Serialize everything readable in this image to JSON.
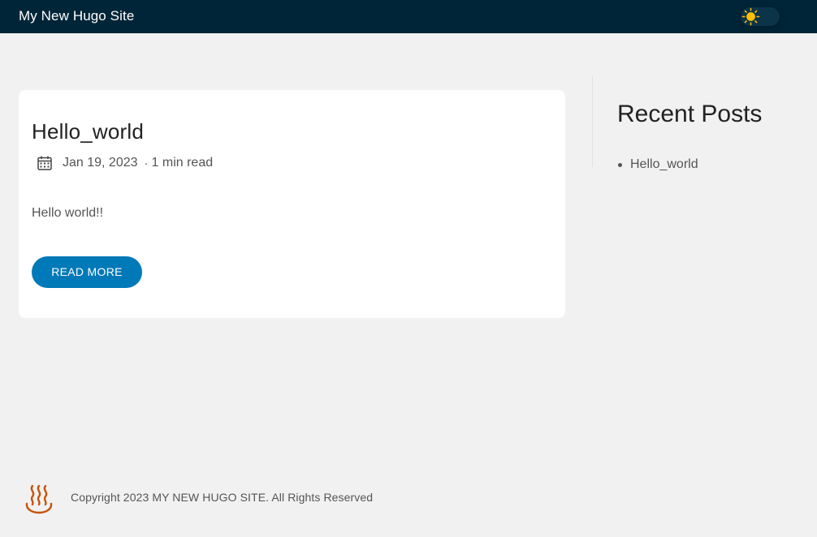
{
  "header": {
    "site_title": "My New Hugo Site",
    "theme_toggle_icon": "sun-icon",
    "theme_mode": "light"
  },
  "post": {
    "title": "Hello_world",
    "date": "Jan 19, 2023",
    "separator": "·",
    "reading_time": "1 min read",
    "summary": "Hello world!!",
    "read_more_label": "READ MORE"
  },
  "sidebar": {
    "title": "Recent Posts",
    "items": [
      {
        "label": "Hello_world"
      }
    ]
  },
  "footer": {
    "logo_icon": "hot-springs-icon",
    "copyright": "Copyright 2023 MY NEW HUGO SITE. All Rights Reserved"
  },
  "colors": {
    "header_bg": "#002538",
    "accent": "#0079b8",
    "page_bg": "#f1f1f1",
    "sun": "#ffc000",
    "logo": "#c5530b"
  }
}
